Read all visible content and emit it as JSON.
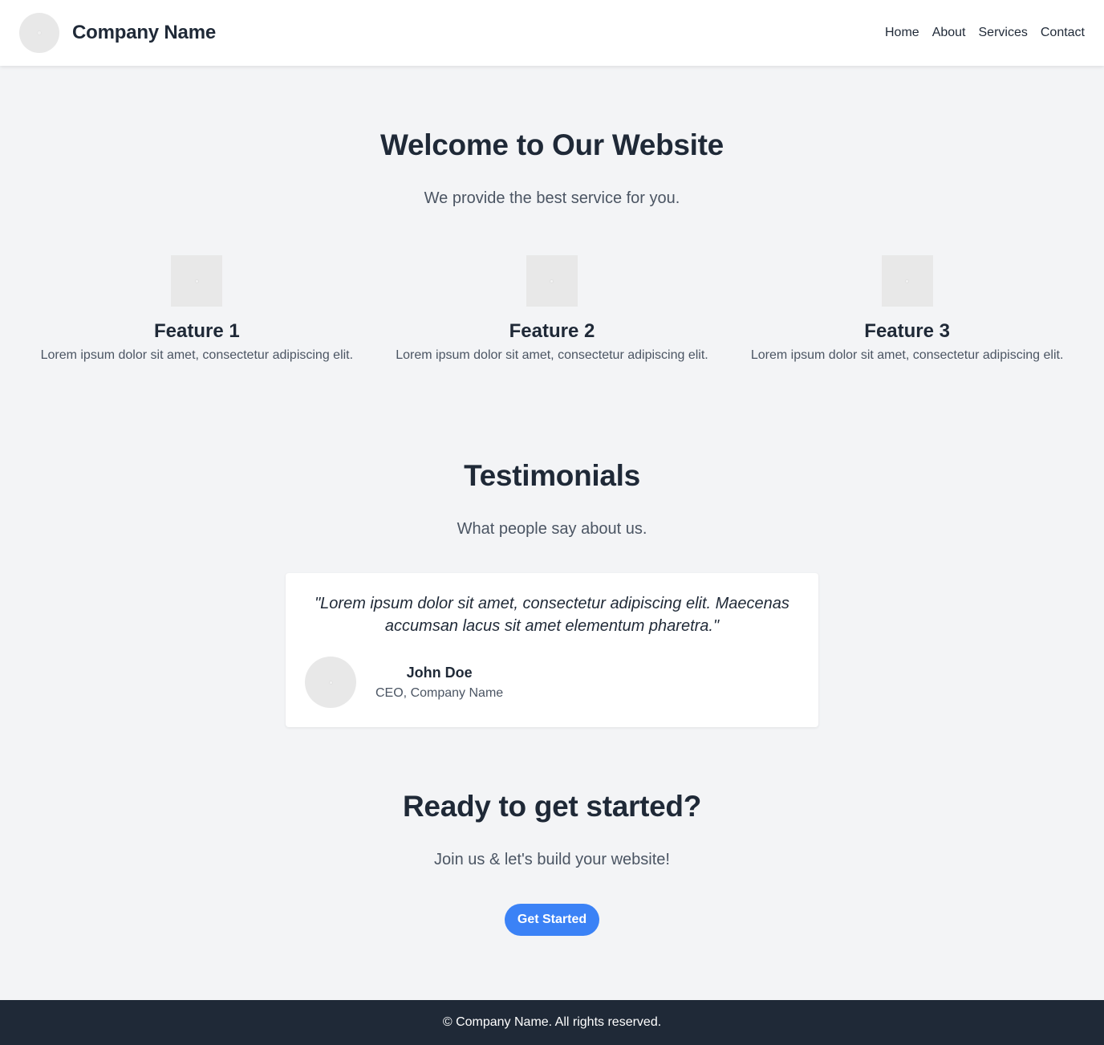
{
  "header": {
    "brand_name": "Company Name",
    "nav": [
      "Home",
      "About",
      "Services",
      "Contact"
    ]
  },
  "hero": {
    "title": "Welcome to Our Website",
    "subtitle": "We provide the best service for you."
  },
  "features": [
    {
      "title": "Feature 1",
      "text": "Lorem ipsum dolor sit amet, consectetur adipiscing elit."
    },
    {
      "title": "Feature 2",
      "text": "Lorem ipsum dolor sit amet, consectetur adipiscing elit."
    },
    {
      "title": "Feature 3",
      "text": "Lorem ipsum dolor sit amet, consectetur adipiscing elit."
    }
  ],
  "testimonials": {
    "title": "Testimonials",
    "subtitle": "What people say about us.",
    "quote": "\"Lorem ipsum dolor sit amet, consectetur adipiscing elit. Maecenas accumsan lacus sit amet elementum pharetra.\"",
    "author_name": "John Doe",
    "author_role": "CEO, Company Name"
  },
  "cta": {
    "title": "Ready to get started?",
    "subtitle": "Join us & let's build your website!",
    "button_label": "Get Started"
  },
  "footer": {
    "text": "© Company Name. All rights reserved."
  },
  "colors": {
    "background": "#f3f4f6",
    "text_dark": "#1f2937",
    "text_muted": "#4b5563",
    "accent": "#3b82f6",
    "footer_bg": "#1f2937"
  },
  "icons": {
    "logo": "image-placeholder-icon",
    "feature": "image-placeholder-icon",
    "avatar": "avatar-placeholder-icon"
  }
}
